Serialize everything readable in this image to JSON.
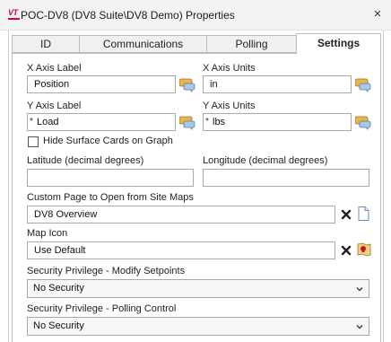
{
  "window": {
    "title": "POC-DV8 (DV8 Suite\\DV8 Demo) Properties",
    "logo_text": "VT",
    "close_glyph": "×"
  },
  "tabs": [
    {
      "label": "ID",
      "active": false
    },
    {
      "label": "Communications",
      "active": false
    },
    {
      "label": "Polling",
      "active": false
    },
    {
      "label": "Settings",
      "active": true
    }
  ],
  "settings": {
    "x_axis_label": {
      "label": "X Axis Label",
      "value": "Position",
      "required": false
    },
    "x_axis_units": {
      "label": "X Axis Units",
      "value": "in",
      "required": false
    },
    "y_axis_label": {
      "label": "Y Axis Label",
      "value": "Load",
      "required": true
    },
    "y_axis_units": {
      "label": "Y Axis Units",
      "value": "lbs",
      "required": true
    },
    "required_marker": "*",
    "hide_surface_cards": {
      "label": "Hide Surface Cards on Graph",
      "checked": false
    },
    "latitude": {
      "label": "Latitude (decimal degrees)",
      "value": ""
    },
    "longitude": {
      "label": "Longitude (decimal degrees)",
      "value": ""
    },
    "custom_page": {
      "label": "Custom Page to Open from Site Maps",
      "value": "DV8 Overview"
    },
    "map_icon": {
      "label": "Map Icon",
      "value": "Use Default"
    },
    "security_setpoints": {
      "label": "Security Privilege - Modify Setpoints",
      "selected": "No Security"
    },
    "security_polling": {
      "label": "Security Privilege - Polling Control",
      "selected": "No Security"
    }
  },
  "icons": {
    "comment": "speech-bubble-icon",
    "clear": "clear-x-icon",
    "page": "blank-page-icon",
    "map_pin": "map-icon-picker-icon",
    "chevron": "chevron-down-icon",
    "accent_gold": "#e8b64a",
    "accent_blue": "#6a8fb5",
    "brand_red": "#c8102e"
  }
}
